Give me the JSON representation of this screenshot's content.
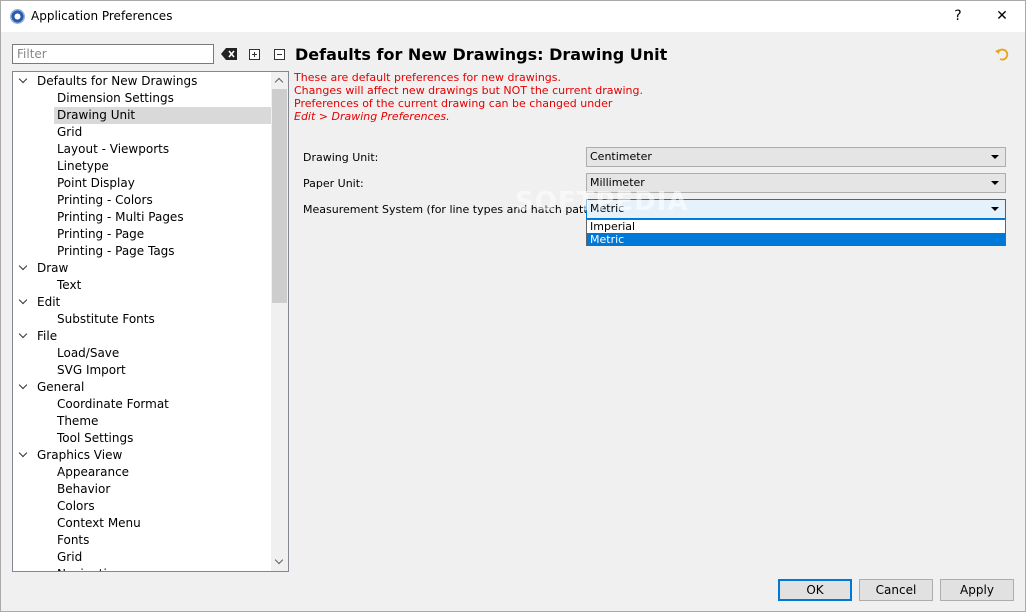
{
  "window": {
    "title": "Application Preferences",
    "help_glyph": "?",
    "close_glyph": "✕"
  },
  "sidebar": {
    "filter_placeholder": "Filter",
    "tree": [
      {
        "label": "Defaults for New Drawings",
        "level": 0,
        "expanded": true
      },
      {
        "label": "Dimension Settings",
        "level": 1
      },
      {
        "label": "Drawing Unit",
        "level": 1,
        "selected": true
      },
      {
        "label": "Grid",
        "level": 1
      },
      {
        "label": "Layout - Viewports",
        "level": 1
      },
      {
        "label": "Linetype",
        "level": 1
      },
      {
        "label": "Point Display",
        "level": 1
      },
      {
        "label": "Printing - Colors",
        "level": 1
      },
      {
        "label": "Printing - Multi Pages",
        "level": 1
      },
      {
        "label": "Printing - Page",
        "level": 1
      },
      {
        "label": "Printing - Page Tags",
        "level": 1
      },
      {
        "label": "Draw",
        "level": 0,
        "expanded": true
      },
      {
        "label": "Text",
        "level": 1
      },
      {
        "label": "Edit",
        "level": 0,
        "expanded": true
      },
      {
        "label": "Substitute Fonts",
        "level": 1
      },
      {
        "label": "File",
        "level": 0,
        "expanded": true
      },
      {
        "label": "Load/Save",
        "level": 1
      },
      {
        "label": "SVG Import",
        "level": 1
      },
      {
        "label": "General",
        "level": 0,
        "expanded": true
      },
      {
        "label": "Coordinate Format",
        "level": 1
      },
      {
        "label": "Theme",
        "level": 1
      },
      {
        "label": "Tool Settings",
        "level": 1
      },
      {
        "label": "Graphics View",
        "level": 0,
        "expanded": true
      },
      {
        "label": "Appearance",
        "level": 1
      },
      {
        "label": "Behavior",
        "level": 1
      },
      {
        "label": "Colors",
        "level": 1
      },
      {
        "label": "Context Menu",
        "level": 1
      },
      {
        "label": "Fonts",
        "level": 1
      },
      {
        "label": "Grid",
        "level": 1
      },
      {
        "label": "Navigation",
        "level": 1
      }
    ]
  },
  "main": {
    "title": "Defaults for New Drawings: Drawing Unit",
    "notices": [
      "These are default preferences for new drawings.",
      "Changes will affect new drawings but NOT the current drawing.",
      "Preferences of the current drawing can be changed under"
    ],
    "notice_link": "Edit > Drawing Preferences.",
    "fields": [
      {
        "label": "Drawing Unit:",
        "value": "Centimeter"
      },
      {
        "label": "Paper Unit:",
        "value": "Millimeter"
      },
      {
        "label": "Measurement System (for line types and hatch patterns):",
        "value": "Metric"
      }
    ],
    "dropdown_options": [
      {
        "label": "Imperial",
        "selected": false
      },
      {
        "label": "Metric",
        "selected": true
      }
    ],
    "watermark": "SOFTPEDIA"
  },
  "buttons": {
    "ok": "OK",
    "cancel": "Cancel",
    "apply": "Apply"
  },
  "colors": {
    "notice": "#e60000",
    "accent": "#0078d7",
    "selection": "#d9d9d9"
  }
}
